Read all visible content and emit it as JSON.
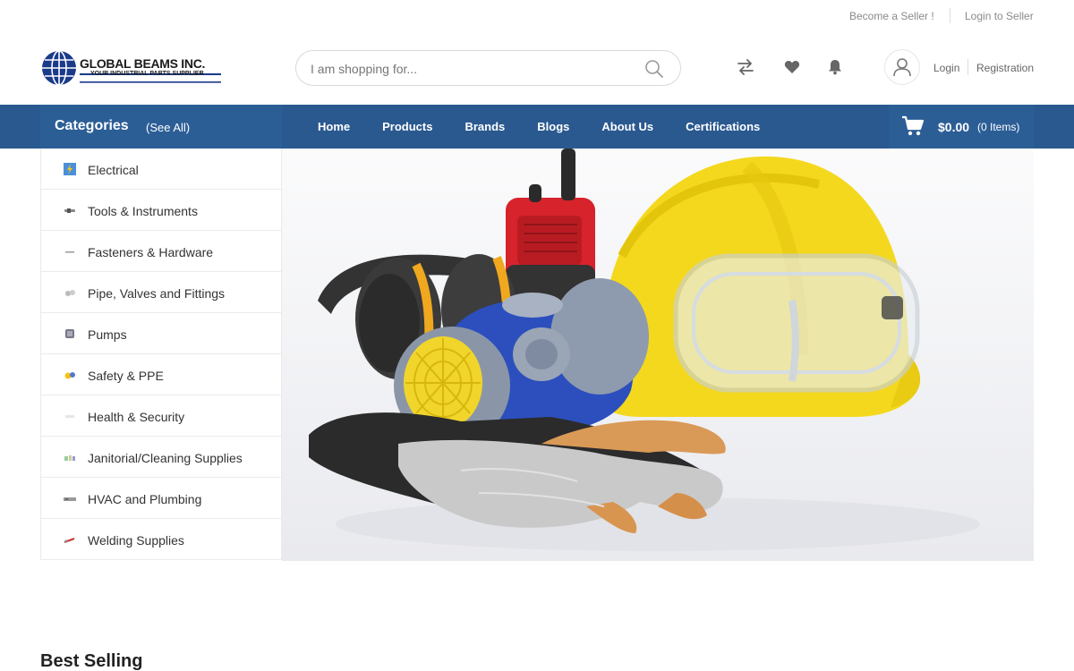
{
  "topbar": {
    "become_seller": "Become a Seller !",
    "login_seller": "Login to Seller"
  },
  "brand": {
    "name": "GLOBAL BEAMS INC.",
    "tagline": "YOUR INDUSTRIAL PARTS SUPPLIER",
    "color": "#1a3a8a"
  },
  "search": {
    "placeholder": "I am shopping for..."
  },
  "header_icons": [
    "compare-icon",
    "wishlist-icon",
    "notification-icon",
    "user-icon"
  ],
  "auth": {
    "login": "Login",
    "registration": "Registration"
  },
  "nav": {
    "categories_title": "Categories",
    "see_all": "(See All)",
    "links": [
      "Home",
      "Products",
      "Brands",
      "Blogs",
      "About Us",
      "Certifications"
    ]
  },
  "cart": {
    "amount": "$0.00",
    "items": "(0 Items)"
  },
  "categories": [
    {
      "label": "Electrical",
      "icon": "electrical-icon"
    },
    {
      "label": "Tools & Instruments",
      "icon": "tools-icon"
    },
    {
      "label": "Fasteners & Hardware",
      "icon": "fasteners-icon"
    },
    {
      "label": "Pipe, Valves and Fittings",
      "icon": "pipe-icon"
    },
    {
      "label": "Pumps",
      "icon": "pump-icon"
    },
    {
      "label": "Safety & PPE",
      "icon": "safety-icon"
    },
    {
      "label": "Health & Security",
      "icon": "health-icon"
    },
    {
      "label": "Janitorial/Cleaning Supplies",
      "icon": "cleaning-icon"
    },
    {
      "label": "HVAC and Plumbing",
      "icon": "hvac-icon"
    },
    {
      "label": "Welding Supplies",
      "icon": "welding-icon"
    }
  ],
  "sections": {
    "best_selling": "Best Selling"
  },
  "colors": {
    "nav_bg": "#2a5990",
    "accent_blue": "#2c5e96"
  }
}
